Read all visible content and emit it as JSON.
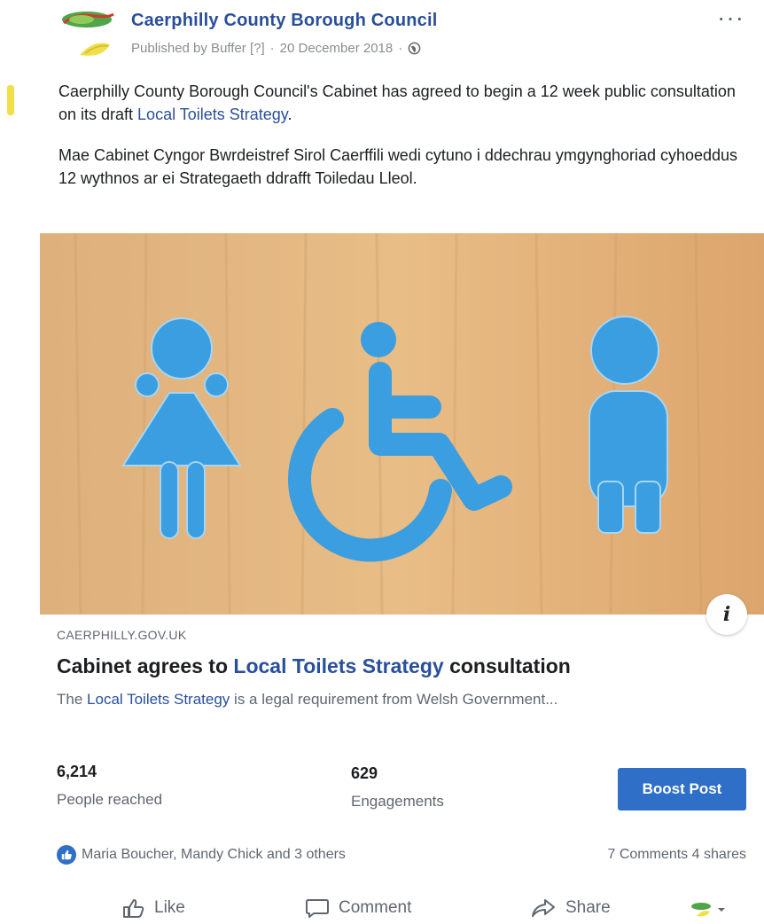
{
  "post": {
    "page_name": "Caerphilly County Borough Council",
    "published_by": "Published by Buffer [?]",
    "date": "20 December 2018",
    "separator": "·",
    "more_label": "···",
    "text_en_before": "Caerphilly County Borough Council's Cabinet has agreed to begin a 12 week public consultation on its draft ",
    "text_en_link": "Local Toilets Strategy",
    "text_en_after": ".",
    "text_cy": "Mae Cabinet Cyngor Bwrdeistref Sirol Caerffili wedi cytuno i ddechrau ymgynghoriad cyhoeddus 12 wythnos ar ei Strategaeth ddrafft Toiledau Lleol."
  },
  "preview": {
    "domain": "CAERPHILLY.GOV.UK",
    "headline_before": "Cabinet agrees to ",
    "headline_link": "Local Toilets Strategy",
    "headline_after": " consultation",
    "desc_before": "The ",
    "desc_link": "Local Toilets Strategy",
    "desc_after": " is a legal requirement from Welsh Government...",
    "info_label": "i"
  },
  "stats": {
    "reached_value": "6,214",
    "reached_label": "People reached",
    "engagements_value": "629",
    "engagements_label": "Engagements",
    "boost_label": "Boost Post"
  },
  "reactions": {
    "names": "Maria Boucher, Mandy Chick and 3 others",
    "counts": "7 Comments  4 shares"
  },
  "actions": {
    "like": "Like",
    "comment": "Comment",
    "share": "Share"
  },
  "colors": {
    "link_blue": "#2a4f9a",
    "boost_blue": "#2f6fc7",
    "sign_blue": "#3a9ee0",
    "wood": "#e3b27a"
  }
}
